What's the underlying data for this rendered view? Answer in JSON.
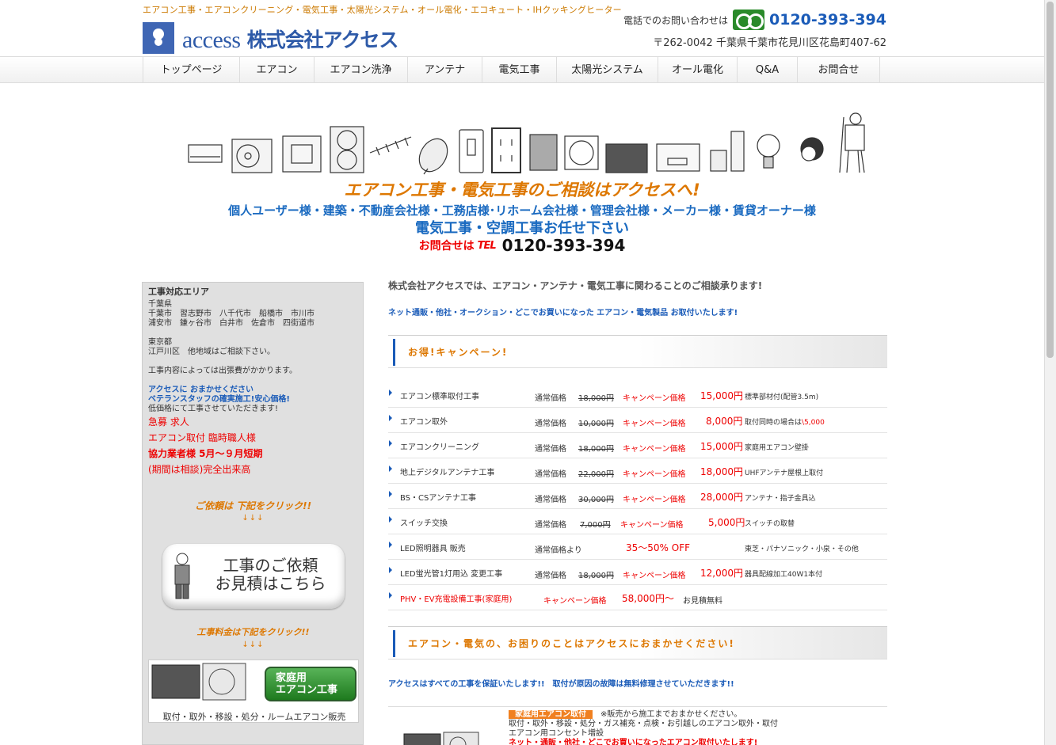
{
  "header": {
    "tagline": "エアコン工事・エアコンクリーニング・電気工事・太陽光システム・オール電化・エコキュート・IHクッキングヒーター",
    "logo_text": "access",
    "logo_jp": "株式会社アクセス",
    "contact_label": "電話でのお問い合わせは",
    "phone": "0120-393-394",
    "address": "〒262-0042 千葉県千葉市花見川区花島町407-62"
  },
  "nav": [
    "トップページ",
    "エアコン",
    "エアコン洗浄",
    "アンテナ",
    "電気工事",
    "太陽光システム",
    "オール電化",
    "Q&A",
    "お問合せ"
  ],
  "hero": {
    "line1": "エアコン工事・電気工事のご相談はアクセスへ!",
    "line2": "個人ユーザー様・建築・不動産会社様・工務店様･リホーム会社様・管理会社様・メーカー様・賃貸オーナー様",
    "line3": "電気工事・空調工事お任せ下さい",
    "contact_label": "お問合せは",
    "tel_mark": "TEL",
    "phone": "0120-393-394"
  },
  "sidebar": {
    "area_title": "工事対応エリア",
    "chiba": "千葉県\n千葉市　習志野市　八千代市　船橋市　市川市\n浦安市　鎌ヶ谷市　白井市　佐倉市　四街道市",
    "tokyo": "東京都\n江戸川区　他地域はご相談下さい。",
    "note": "工事内容によっては出張費がかかります。",
    "blue1": "アクセスに おまかせください",
    "blue2": "ベテランスタッフの確実施工!安心価格!",
    "text3": "低価格にて工事させていただきます!",
    "red1": "急募 求人",
    "red2": "エアコン取付 臨時職人様",
    "red3": "協力業者様 5月～９月短期",
    "red4": "(期間は相談)完全出来高",
    "cta1": "ご依頼は 下記をクリック!!",
    "arrows1": "↓↓↓",
    "request_button": "工事のご依頼\nお見積はこちら",
    "cta2": "工事料金は下記をクリック!!",
    "arrows2": "↓↓↓",
    "ad_button": "家庭用\nエアコン工事",
    "ad_caption": "取付・取外・移設・処分・ルームエアコン販売"
  },
  "main": {
    "intro": "株式会社アクセスでは、エアコン・アンテナ・電気工事に関わることのご相談承ります!",
    "intro2": "ネット通販・他社・オークション・どこでお買いになった エアコン・電気製品 お取付いたします!",
    "campaign_title": "お得!キャンペーン!",
    "regular_label": "通常価格",
    "campaign_label": "キャンペーン価格",
    "rows": [
      {
        "name": "エアコン標準取付工事",
        "regular": "18,000円",
        "price": "15,000円",
        "note": "標準部材付(配管3.5m)"
      },
      {
        "name": "エアコン取外",
        "regular": "10,000円",
        "price": "8,000円",
        "note": "取付同時の場合は",
        "note_red": "\\5,000"
      },
      {
        "name": "エアコンクリーニング",
        "regular": "18,000円",
        "price": "15,000円",
        "note": "家庭用エアコン壁掛"
      },
      {
        "name": "地上デジタルアンテナ工事",
        "regular": "22,000円",
        "price": "18,000円",
        "note": "UHFアンテナ屋根上取付"
      },
      {
        "name": "BS・CSアンテナ工事",
        "regular": "30,000円",
        "price": "28,000円",
        "note": "アンテナ・指子金具込"
      },
      {
        "name": "スイッチ交換",
        "regular": "7,000円",
        "price": "5,000円",
        "note": "スイッチの取替"
      },
      {
        "name": "LED照明器具 販売",
        "regular_label2": "通常価格より",
        "price": "35～50% OFF",
        "note": "東芝・パナソニック・小泉・その他"
      },
      {
        "name": "LED蛍光管1灯用込 変更工事",
        "regular": "18,000円",
        "price": "12,000円",
        "note": "器具配線加工40W1本付"
      },
      {
        "name": "PHV・EV充電設備工事(家庭用)",
        "price": "58,000円～",
        "note": "お見積無料"
      }
    ],
    "trouble_title": "エアコン・電気の、お困りのことはアクセスにおまかせください!",
    "guarantee": "アクセスはすべての工事を保証いたします!!　取付が原因の故障は無料修理させていただきます!!",
    "home_label": "家庭用エアコン取付",
    "home_line1": "※販売から施工までおまかせください。",
    "home_line2": "取付・取外・移設・処分・ガス補充・点検・お引越しのエアコン取外・取付",
    "home_line3": "エアコン用コンセント増設",
    "home_line4": "ネット・通販・他社・どこでお買いになったエアコン取付いたします!"
  },
  "colors": {
    "accent_orange": "#dd7700",
    "brand_blue": "#1a5bb8",
    "campaign_red": "#e00000",
    "freedial_green": "#2a8a2a"
  }
}
